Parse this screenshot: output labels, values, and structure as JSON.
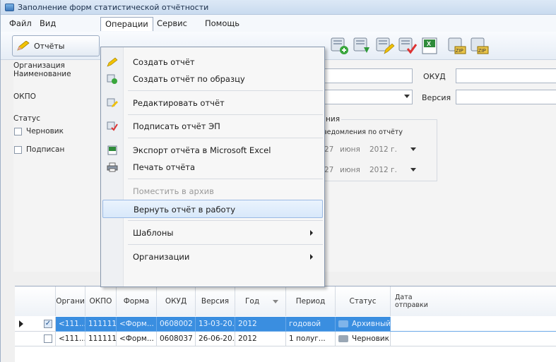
{
  "window": {
    "title": "Заполнение форм статистической отчётности"
  },
  "menubar": [
    "Файл",
    "Вид",
    "Операции",
    "Сервис",
    "Помощь"
  ],
  "toolbar": {
    "reports_label": "Отчёты"
  },
  "filters": {
    "org_group_label": "Организация",
    "name_label": "Наименование",
    "okpo_label": "ОКПО",
    "okud_label": "ОКУД",
    "version_label": "Версия",
    "status_group_label": "Статус",
    "status_draft": "Черновик",
    "status_signed": "Подписан",
    "notice_group_label": "ния",
    "notice_sub_label": "ведомления по отчёту",
    "date1": {
      "day": "27",
      "month": "июня",
      "year": "2012 г."
    },
    "date2": {
      "day": "27",
      "month": "июня",
      "year": "2012 г."
    }
  },
  "dropdown": {
    "items": [
      {
        "label": "Создать отчёт",
        "icon": "create-report-icon"
      },
      {
        "label": "Создать отчёт по образцу",
        "icon": "create-from-template-icon"
      },
      {
        "label": "Редактировать отчёт",
        "icon": "edit-report-icon"
      },
      {
        "label": "Подписать отчёт ЭП",
        "icon": "sign-report-icon"
      },
      {
        "label": "Экспорт отчёта в Microsoft Excel",
        "icon": "excel-export-icon"
      },
      {
        "label": "Печать отчёта",
        "icon": "print-icon"
      },
      {
        "label": "Поместить в архив",
        "disabled": true
      },
      {
        "label": "Вернуть отчёт в работу",
        "highlighted": true
      },
      {
        "label": "Шаблоны",
        "submenu": true
      },
      {
        "label": "Организации",
        "submenu": true
      }
    ]
  },
  "grid": {
    "headers": [
      "Органи",
      "ОКПО",
      "Форма",
      "ОКУД",
      "Версия",
      "Год",
      "Период",
      "Статус",
      "Дата отправки"
    ],
    "rows": [
      {
        "org": "<111...",
        "okpo": "11111111",
        "form": "<Форм...",
        "okud": "0608002",
        "version": "13-03-20...",
        "year": "2012",
        "period": "годовой",
        "status": "Архивный",
        "checked": true,
        "selected": true
      },
      {
        "org": "<111...",
        "okpo": "11111111",
        "form": "<Форм...",
        "okud": "0608037",
        "version": "26-06-20...",
        "year": "2012",
        "period": "1 полуг...",
        "status": "Черновик",
        "checked": false,
        "selected": false
      }
    ]
  },
  "colors": {
    "selection": "#3a8ee0",
    "menu_highlight": "#d8e8fa",
    "title_bar": "#c9dbef"
  }
}
